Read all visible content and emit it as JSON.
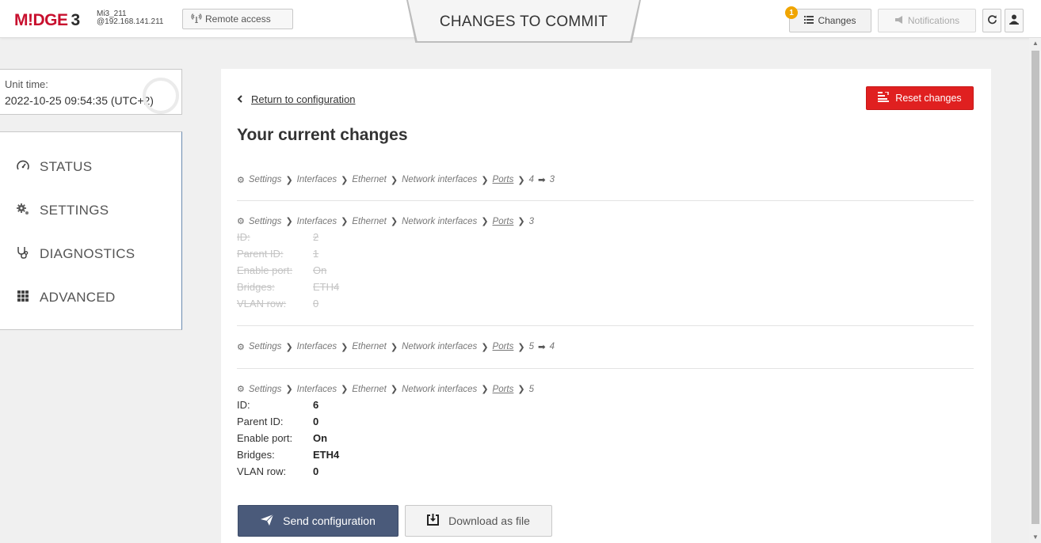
{
  "topbar": {
    "logo_main": "M!DGE",
    "logo_num": "3",
    "device_name": "Mi3_211",
    "device_ip": "@192.168.141.211",
    "remote_label": "Remote access",
    "page_title": "CHANGES TO COMMIT",
    "changes_label": "Changes",
    "changes_count": "1",
    "notifications_label": "Notifications"
  },
  "sidebar": {
    "unit_time_label": "Unit time:",
    "unit_time_value": "2022-10-25 09:54:35 (UTC+2)",
    "items": [
      {
        "label": "STATUS",
        "icon": "speedometer-icon"
      },
      {
        "label": "SETTINGS",
        "icon": "gears-icon"
      },
      {
        "label": "DIAGNOSTICS",
        "icon": "stethoscope-icon"
      },
      {
        "label": "ADVANCED",
        "icon": "grid-icon"
      }
    ]
  },
  "main": {
    "return_label": "Return to configuration",
    "reset_label": "Reset changes",
    "heading": "Your current changes",
    "crumb": {
      "settings": "Settings",
      "interfaces": "Interfaces",
      "ethernet": "Ethernet",
      "network_interfaces": "Network interfaces",
      "ports": "Ports"
    },
    "changes": [
      {
        "from": "4",
        "to": "3"
      },
      {
        "target": "3"
      },
      {
        "from": "5",
        "to": "4"
      },
      {
        "target": "5"
      }
    ],
    "fields": {
      "id": "ID:",
      "parent_id": "Parent ID:",
      "enable_port": "Enable port:",
      "bridges": "Bridges:",
      "vlan_row": "VLAN row:"
    },
    "deleted": {
      "id": "2",
      "parent_id": "1",
      "enable_port": "On",
      "bridges": "ETH4",
      "vlan_row": "0"
    },
    "added": {
      "id": "6",
      "parent_id": "0",
      "enable_port": "On",
      "bridges": "ETH4",
      "vlan_row": "0"
    },
    "send_label": "Send configuration",
    "download_label": "Download as file"
  },
  "colors": {
    "brand": "#c8102e",
    "reset": "#e02020",
    "send": "#4a5a7a",
    "badge": "#f0a500"
  }
}
